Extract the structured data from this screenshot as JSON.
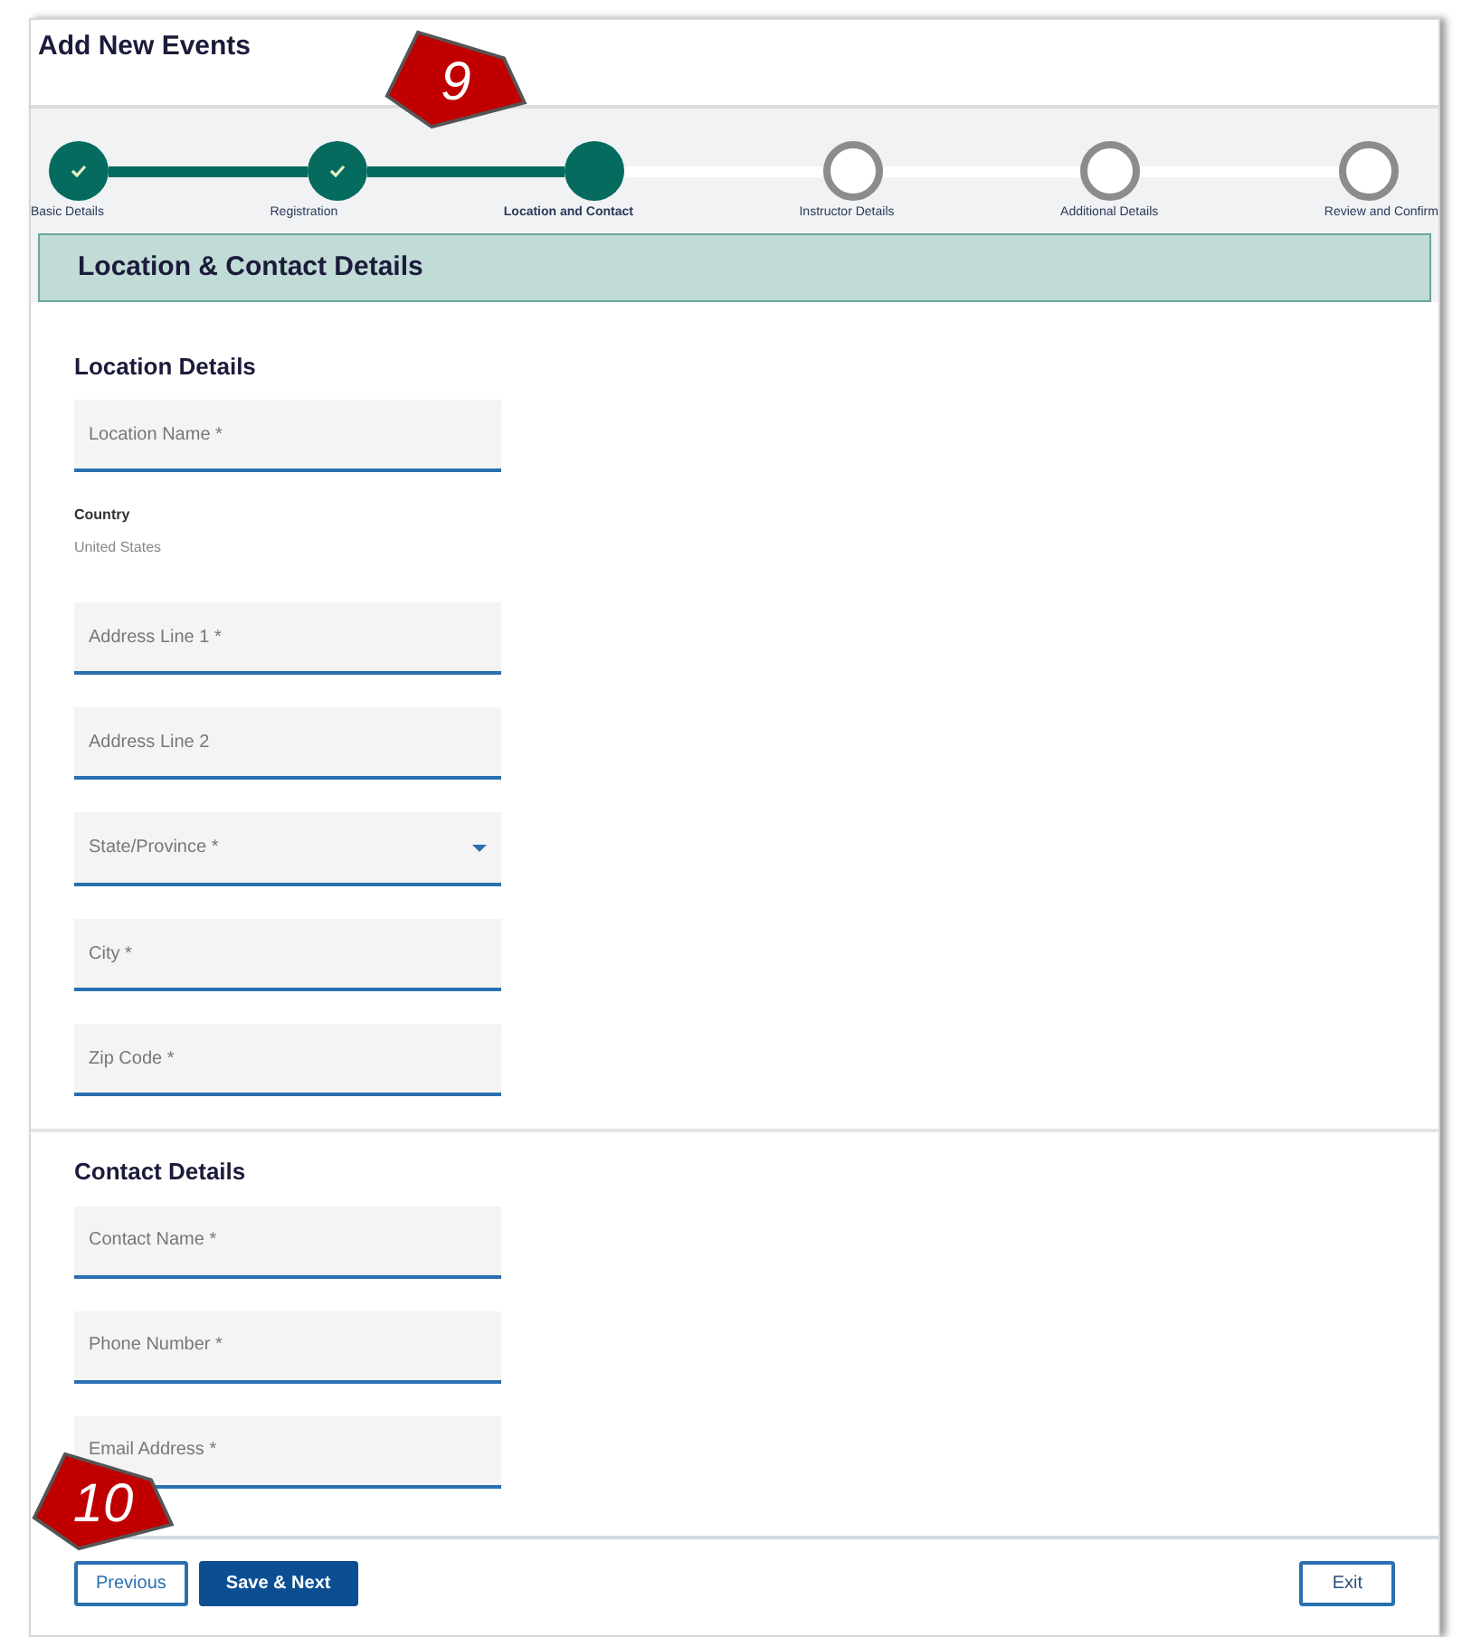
{
  "title": "Add New Events",
  "steps": [
    {
      "label": "Basic Details",
      "completed": true,
      "selected": false
    },
    {
      "label": "Registration",
      "completed": true,
      "selected": false
    },
    {
      "label": "Location and Contact",
      "completed": false,
      "selected": true
    },
    {
      "label": "Instructor Details",
      "completed": false,
      "selected": false
    },
    {
      "label": "Additional Details",
      "completed": false,
      "selected": false
    },
    {
      "label": "Review and Confirm",
      "completed": false,
      "selected": false
    }
  ],
  "section_title": "Location & Contact Details",
  "location": {
    "heading": "Location Details",
    "fields": [
      {
        "kind": "text",
        "placeholder": "Location Name *"
      },
      {
        "kind": "static",
        "label": "Country",
        "value": "United States"
      },
      {
        "kind": "text",
        "placeholder": "Address Line 1 *"
      },
      {
        "kind": "text",
        "placeholder": "Address Line 2"
      },
      {
        "kind": "select",
        "placeholder": "State/Province *"
      },
      {
        "kind": "text",
        "placeholder": "City *"
      },
      {
        "kind": "text",
        "placeholder": "Zip Code *"
      }
    ]
  },
  "contact": {
    "heading": "Contact Details",
    "fields": [
      {
        "kind": "text",
        "placeholder": "Contact Name *"
      },
      {
        "kind": "text",
        "placeholder": "Phone Number *"
      },
      {
        "kind": "text",
        "placeholder": "Email Address *"
      }
    ]
  },
  "buttons": [
    {
      "label": "Previous",
      "kind": "outline"
    },
    {
      "label": "Save & Next",
      "kind": "primary"
    },
    {
      "label": "Exit",
      "kind": "outline-end"
    }
  ],
  "callouts": [
    {
      "text": "9"
    },
    {
      "text": "10"
    }
  ]
}
